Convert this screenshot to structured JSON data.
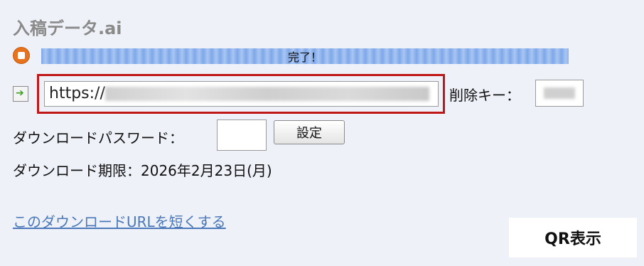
{
  "title": "入稿データ.ai",
  "progress": {
    "text": "完了！",
    "value": 1.0
  },
  "url_field": {
    "value_prefix": "https://"
  },
  "delete_key": {
    "label": "削除キー："
  },
  "password": {
    "label": "ダウンロードパスワード：",
    "value": "",
    "button": "設定"
  },
  "expiry": {
    "text": "ダウンロード期限：2026年2月23日(月)"
  },
  "shorten_link": "このダウンロードURLを短くする",
  "qr_button": "QR表示",
  "colors": {
    "highlight_border": "#c01818",
    "progress_blue": "#7fa8ea",
    "link": "#4a78b8",
    "stop_orange": "#e8731e"
  },
  "icons": [
    "stop-icon",
    "arrow-right-icon"
  ]
}
